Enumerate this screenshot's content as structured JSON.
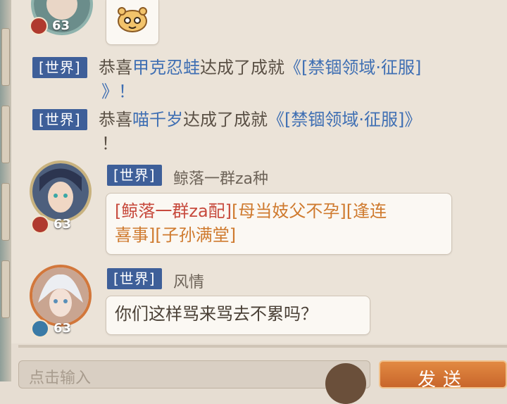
{
  "messages": [
    {
      "type": "partial_user",
      "level": "63",
      "sticker": "hamster-face-sticker"
    },
    {
      "type": "system",
      "channel": "[世界]",
      "prefix": "恭喜",
      "player": "甲克忍蛙",
      "mid": "达成了成就",
      "achievement": "《[禁锢领域·征服]",
      "suffix": "》！"
    },
    {
      "type": "system",
      "channel": "[世界]",
      "prefix": "恭喜",
      "player": "喵千岁",
      "mid": "达成了成就",
      "achievement": "《[禁锢领域·征服]》",
      "suffix": "！"
    },
    {
      "type": "user",
      "channel": "[世界]",
      "name": "鲸落一群za种",
      "level": "63",
      "segments": [
        {
          "text": "[鲸落一群za配]",
          "color": "red"
        },
        {
          "text": "[母当妓父不孕]",
          "color": "orange"
        },
        {
          "text": "[逢连",
          "color": "orange"
        },
        {
          "text": "喜事]",
          "color": "orange"
        },
        {
          "text": "[子孙满堂]",
          "color": "orange"
        }
      ]
    },
    {
      "type": "user",
      "channel": "[世界]",
      "name": "风情",
      "level": "63",
      "text": "你们这样骂来骂去不累吗？"
    }
  ],
  "input": {
    "placeholder": "点击输入"
  },
  "send_button": {
    "label": "发送"
  },
  "colors": {
    "channel_tag": "#3e5f99",
    "highlight_blue": "#3f6fb3",
    "title_red": "#c74a3d",
    "title_orange": "#cf7a2e",
    "send_button": "#d9773a"
  }
}
